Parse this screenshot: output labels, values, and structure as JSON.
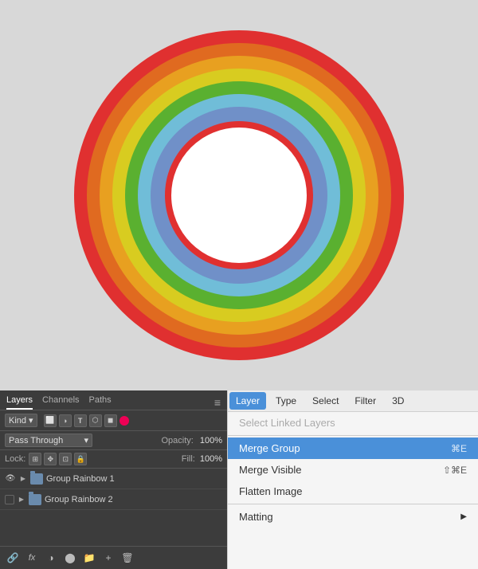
{
  "canvas": {
    "background": "#d8d8d8"
  },
  "rainbow": {
    "rings": [
      {
        "size": 420,
        "color": "#e03030"
      },
      {
        "size": 390,
        "color": "#e06020"
      },
      {
        "size": 362,
        "color": "#e8a020"
      },
      {
        "size": 334,
        "color": "#d8d020"
      },
      {
        "size": 306,
        "color": "#60b030"
      },
      {
        "size": 278,
        "color": "#60c0d8"
      },
      {
        "size": 250,
        "color": "#7090d0"
      },
      {
        "size": 200,
        "color": "#e03030"
      },
      {
        "size": 172,
        "color": "#e06020"
      },
      {
        "size": 144,
        "color": "#e8a020"
      },
      {
        "size": 116,
        "color": "#d8d020"
      },
      {
        "size": 88,
        "color": "#60b030"
      },
      {
        "size": 60,
        "color": "#7090d0"
      },
      {
        "size": 32,
        "color": "#ffffff"
      }
    ]
  },
  "layers_panel": {
    "tabs": [
      {
        "label": "Layers",
        "active": true
      },
      {
        "label": "Channels",
        "active": false
      },
      {
        "label": "Paths",
        "active": false
      }
    ],
    "kind_label": "Kind",
    "pass_through_label": "Pass Through",
    "opacity_label": "Opacity:",
    "opacity_value": "100%",
    "lock_label": "Lock:",
    "fill_label": "Fill:",
    "fill_value": "100%",
    "layers": [
      {
        "name": "Group Rainbow 1",
        "visible": true,
        "has_check": false
      },
      {
        "name": "Group Rainbow 2",
        "visible": false,
        "has_check": true
      }
    ],
    "bottom_icons": [
      "link",
      "fx",
      "camera",
      "circle",
      "folder",
      "trash"
    ]
  },
  "menu_bar": {
    "items": [
      {
        "label": "Layer",
        "active": true
      },
      {
        "label": "Type",
        "active": false
      },
      {
        "label": "Select",
        "active": false
      },
      {
        "label": "Filter",
        "active": false
      },
      {
        "label": "3D",
        "active": false
      }
    ]
  },
  "context_menu": {
    "items": [
      {
        "label": "Select Linked Layers",
        "shortcut": "",
        "disabled": true,
        "has_arrow": false
      },
      {
        "label": "Merge Group",
        "shortcut": "⌘E",
        "disabled": false,
        "highlighted": true,
        "has_arrow": false
      },
      {
        "label": "Merge Visible",
        "shortcut": "⇧⌘E",
        "disabled": false,
        "highlighted": false,
        "has_arrow": false
      },
      {
        "label": "Flatten Image",
        "shortcut": "",
        "disabled": false,
        "highlighted": false,
        "has_arrow": false
      },
      {
        "label": "Matting",
        "shortcut": "",
        "disabled": false,
        "highlighted": false,
        "has_arrow": true
      }
    ]
  }
}
